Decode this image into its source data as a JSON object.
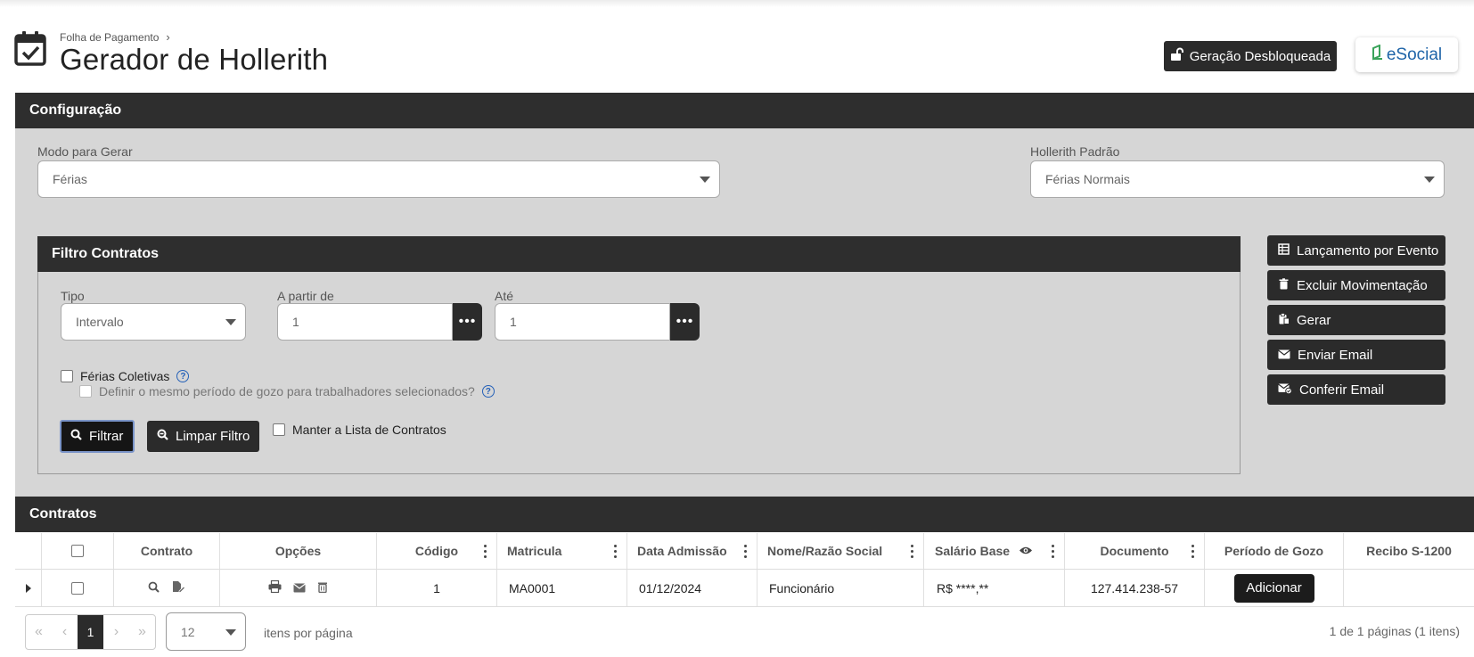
{
  "header": {
    "breadcrumb": "Folha de Pagamento",
    "title": "Gerador de Hollerith",
    "unlock_label": "Geração Desbloqueada",
    "esocial_label": "eSocial"
  },
  "config": {
    "title": "Configuração",
    "modo_label": "Modo para Gerar",
    "modo_value": "Férias",
    "hollerith_label": "Hollerith Padrão",
    "hollerith_value": "Férias Normais"
  },
  "filtro": {
    "title": "Filtro Contratos",
    "tipo_label": "Tipo",
    "tipo_value": "Intervalo",
    "apartir_label": "A partir de",
    "apartir_value": "1",
    "ate_label": "Até",
    "ate_value": "1",
    "ferias_coletivas": "Férias Coletivas",
    "definir_periodo": "Definir o mesmo período de gozo para trabalhadores selecionados?",
    "filtrar": "Filtrar",
    "limpar": "Limpar Filtro",
    "manter": "Manter a Lista de Contratos"
  },
  "actions": [
    {
      "label": "Lançamento por Evento",
      "icon": "table-icon"
    },
    {
      "label": "Excluir Movimentação",
      "icon": "trash-icon"
    },
    {
      "label": "Gerar",
      "icon": "clipboard-icon"
    },
    {
      "label": "Enviar Email",
      "icon": "envelope-icon"
    },
    {
      "label": "Conferir Email",
      "icon": "envelope-check-icon"
    }
  ],
  "contratos": {
    "title": "Contratos",
    "columns": {
      "contrato": "Contrato",
      "opcoes": "Opções",
      "codigo": "Código",
      "matricula": "Matricula",
      "data_admissao": "Data Admissão",
      "nome": "Nome/Razão Social",
      "salario": "Salário Base",
      "documento": "Documento",
      "periodo": "Período de Gozo",
      "recibo": "Recibo S-1200"
    },
    "rows": [
      {
        "codigo": "1",
        "matricula": "MA0001",
        "data_admissao": "01/12/2024",
        "nome": "Funcionário",
        "salario": "R$ ****,**",
        "documento": "127.414.238-57",
        "periodo_button": "Adicionar",
        "recibo": ""
      }
    ]
  },
  "pagination": {
    "first": "«",
    "prev": "‹",
    "current": "1",
    "next": "›",
    "last": "»",
    "page_size": "12",
    "per_page_label": "itens por página",
    "summary": "1 de 1 páginas (1 itens)"
  }
}
